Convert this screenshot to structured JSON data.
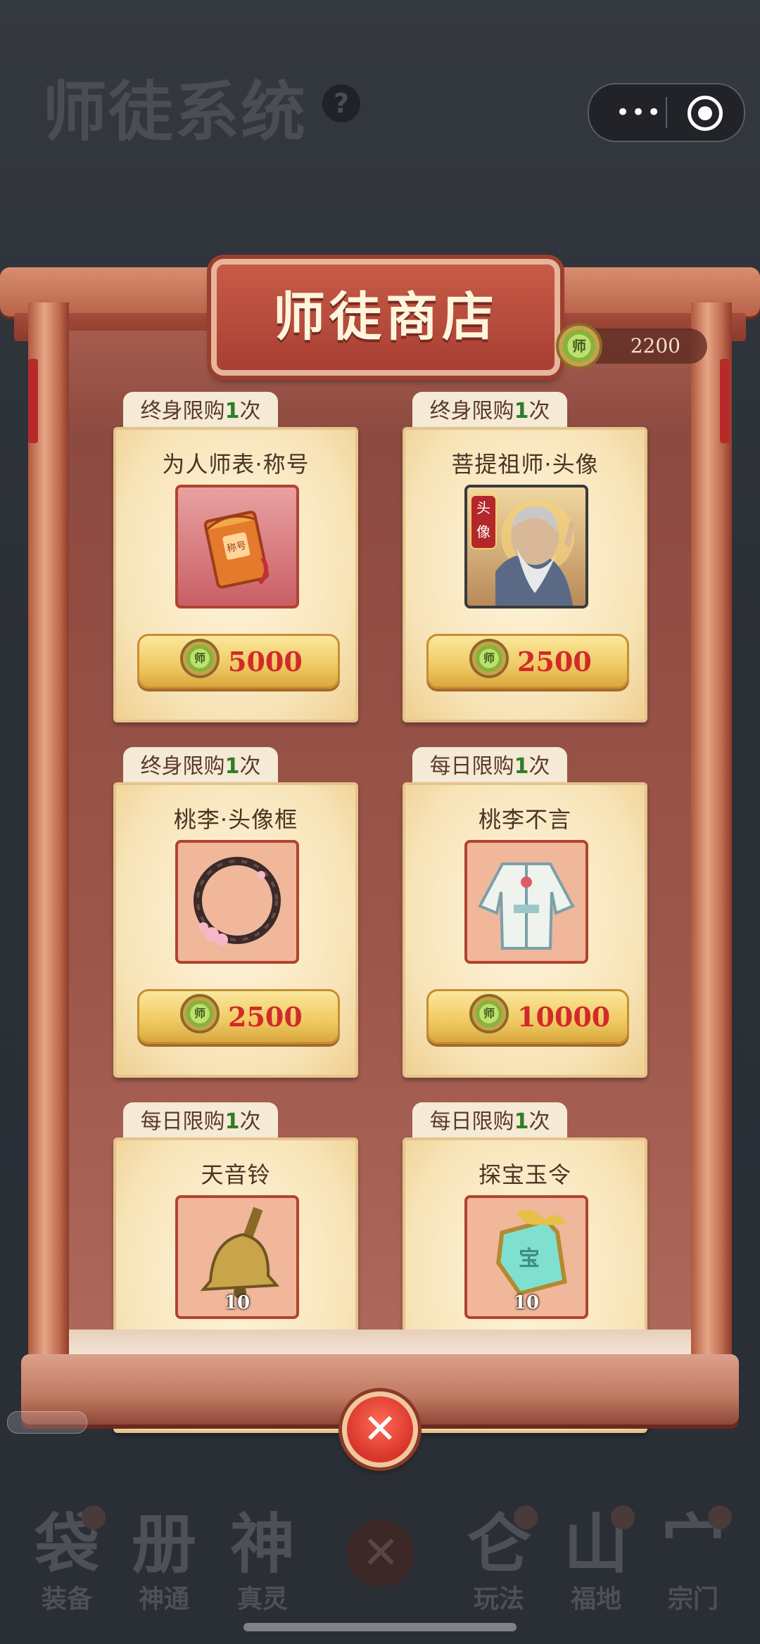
{
  "background": {
    "title": "师徒系统",
    "help_icon": "?",
    "bottom_nav": [
      {
        "label": "装备",
        "glyph": "袋"
      },
      {
        "label": "神通",
        "glyph": "册"
      },
      {
        "label": "真灵",
        "glyph": "神"
      },
      {
        "label": "玩法",
        "glyph": "仑"
      },
      {
        "label": "福地",
        "glyph": "山"
      },
      {
        "label": "宗门",
        "glyph": "宀"
      }
    ]
  },
  "capsule": {
    "more_icon": "•••"
  },
  "shop": {
    "title": "师徒商店",
    "balance": "2200",
    "coin_glyph": "师",
    "items": [
      {
        "limit_prefix": "终身限购",
        "limit_count": "1",
        "limit_suffix": "次",
        "name": "为人师表·称号",
        "price": "5000",
        "qty": "",
        "icon": "title-envelope-icon"
      },
      {
        "limit_prefix": "终身限购",
        "limit_count": "1",
        "limit_suffix": "次",
        "name": "菩提祖师·头像",
        "price": "2500",
        "qty": "",
        "icon": "avatar-portrait-icon",
        "avatar_tag": "头像"
      },
      {
        "limit_prefix": "终身限购",
        "limit_count": "1",
        "limit_suffix": "次",
        "name": "桃李·头像框",
        "price": "2500",
        "qty": "",
        "icon": "avatar-frame-icon"
      },
      {
        "limit_prefix": "每日限购",
        "limit_count": "1",
        "limit_suffix": "次",
        "name": "桃李不言",
        "price": "10000",
        "qty": "",
        "icon": "costume-robe-icon"
      },
      {
        "limit_prefix": "每日限购",
        "limit_count": "1",
        "limit_suffix": "次",
        "name": "天音铃",
        "price": "",
        "qty": "10",
        "icon": "bell-icon"
      },
      {
        "limit_prefix": "每日限购",
        "limit_count": "1",
        "limit_suffix": "次",
        "name": "探宝玉令",
        "price": "",
        "qty": "10",
        "icon": "jade-token-icon"
      }
    ],
    "close_label": "✕"
  }
}
